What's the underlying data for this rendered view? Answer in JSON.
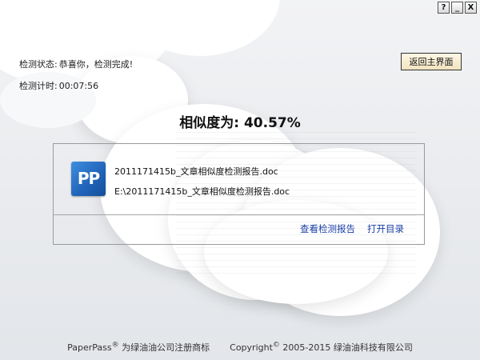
{
  "window": {
    "controls": {
      "help": "?",
      "minimize": "_",
      "close": "X"
    }
  },
  "status": {
    "label": "检测状态:",
    "value": "恭喜你，检测完成!"
  },
  "timer": {
    "label": "检测计时:",
    "value": "00:07:56"
  },
  "back_button": "返回主界面",
  "similarity": {
    "label": "相似度为:",
    "value": "40.57%"
  },
  "result": {
    "icon_text": "PP",
    "file_name": "2011171415b_文章相似度检测报告.doc",
    "file_path": "E:\\2011171415b_文章相似度检测报告.doc",
    "view_report": "查看检测报告",
    "open_folder": "打开目录"
  },
  "footer": {
    "brand": "PaperPass",
    "brand_mark": "®",
    "trademark_text": "为绿油油公司注册商标",
    "copyright_word": "Copyright",
    "copyright_mark": "©",
    "copyright_text": "2005-2015 绿油油科技有限公司"
  }
}
